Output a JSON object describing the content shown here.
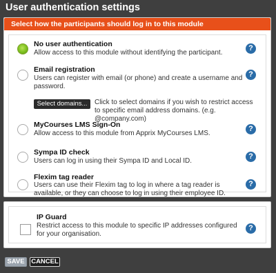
{
  "window": {
    "title": "User authentication settings"
  },
  "banner": {
    "text": "Select how the participants should log in to this module"
  },
  "options": [
    {
      "title": "No user authentication",
      "description": "Allow access to this module without identifying the participant.",
      "selected": true
    },
    {
      "title": "Email registration",
      "description": "Users can register with email (or phone) and create a username and password.",
      "selected": false
    },
    {
      "title": "MyCourses LMS Sign-On",
      "description": "Allow access to this module from Apprix MyCourses LMS.",
      "selected": false
    },
    {
      "title": "Sympa ID check",
      "description": "Users can log in using their Sympa ID and Local ID.",
      "selected": false
    },
    {
      "title": "Flexim tag reader",
      "description": "Users can use their Flexim tag to log in where a tag reader is available, or they can choose to log in using their employee ID.",
      "selected": false
    }
  ],
  "email_registration": {
    "select_domains_label": "Select domains...",
    "select_domains_hint": "Click to select domains if you wish to restrict access to specific email address domains. (e.g. @company.com)"
  },
  "ip_guard": {
    "title": "IP Guard",
    "description": "Restrict access to this module to specific IP addresses configured for your organisation.",
    "checked": false
  },
  "help_icon_glyph": "?",
  "footer": {
    "save_label": "SAVE",
    "cancel_label": "CANCEL"
  },
  "colors": {
    "banner": "#e8501a",
    "help_icon": "#2a6ca8",
    "selected_radio": "#7cbf1e"
  }
}
